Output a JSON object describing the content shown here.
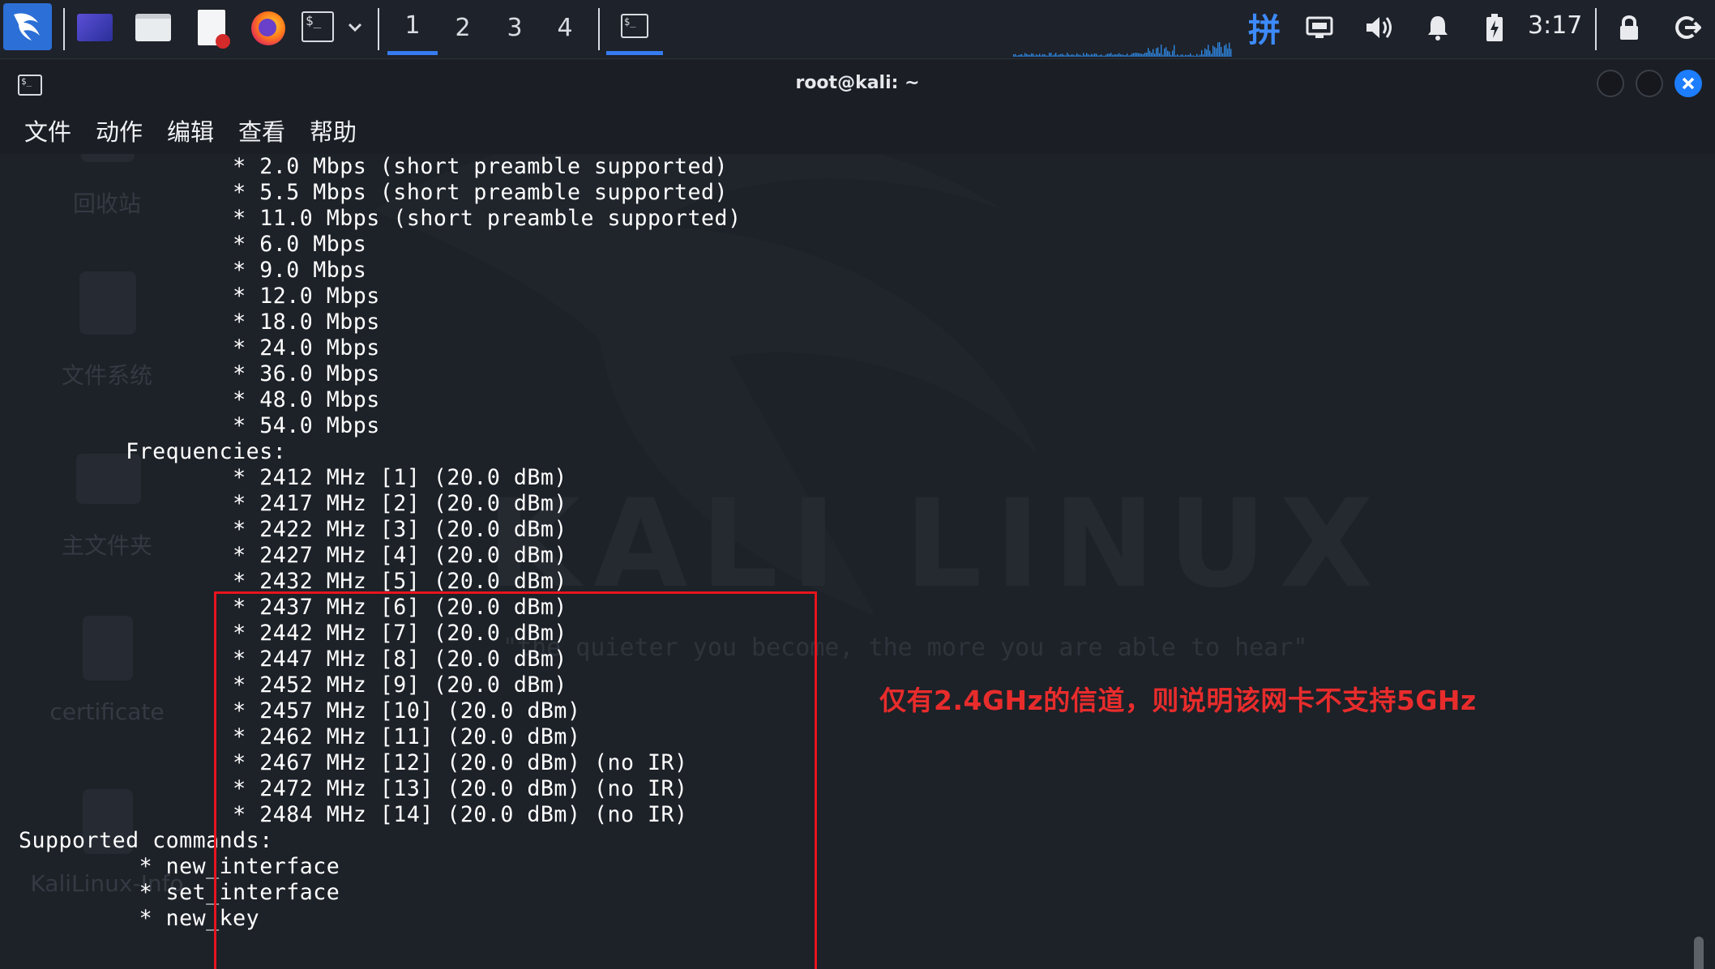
{
  "taskbar": {
    "workspaces": [
      "1",
      "2",
      "3",
      "4"
    ],
    "active_workspace": "1",
    "input_method": "拼",
    "clock": "3:17",
    "launchers": [
      "kali-menu-icon",
      "desktop-icon",
      "file-manager-icon",
      "text-editor-icon",
      "firefox-icon",
      "terminal-icon"
    ],
    "tray_icons": [
      "keyboard-layout-icon",
      "network-icon",
      "volume-icon",
      "notification-bell-icon",
      "battery-charging-icon",
      "lock-icon",
      "logout-icon"
    ]
  },
  "window": {
    "title": "root@kali: ~",
    "menu": [
      "文件",
      "动作",
      "编辑",
      "查看",
      "帮助"
    ]
  },
  "desktop": {
    "icons": [
      "回收站",
      "文件系统",
      "主文件夹",
      "certificate",
      "KaliLinux-Info"
    ],
    "wallpaper_logo": "KALI LINUX",
    "wallpaper_quote": "\"the quieter you become, the more you are able to hear\""
  },
  "terminal": {
    "lines": [
      "\t\t* 2.0 Mbps (short preamble supported)",
      "\t\t* 5.5 Mbps (short preamble supported)",
      "\t\t* 11.0 Mbps (short preamble supported)",
      "\t\t* 6.0 Mbps",
      "\t\t* 9.0 Mbps",
      "\t\t* 12.0 Mbps",
      "\t\t* 18.0 Mbps",
      "\t\t* 24.0 Mbps",
      "\t\t* 36.0 Mbps",
      "\t\t* 48.0 Mbps",
      "\t\t* 54.0 Mbps",
      "\tFrequencies:",
      "\t\t* 2412 MHz [1] (20.0 dBm)",
      "\t\t* 2417 MHz [2] (20.0 dBm)",
      "\t\t* 2422 MHz [3] (20.0 dBm)",
      "\t\t* 2427 MHz [4] (20.0 dBm)",
      "\t\t* 2432 MHz [5] (20.0 dBm)",
      "\t\t* 2437 MHz [6] (20.0 dBm)",
      "\t\t* 2442 MHz [7] (20.0 dBm)",
      "\t\t* 2447 MHz [8] (20.0 dBm)",
      "\t\t* 2452 MHz [9] (20.0 dBm)",
      "\t\t* 2457 MHz [10] (20.0 dBm)",
      "\t\t* 2462 MHz [11] (20.0 dBm)",
      "\t\t* 2467 MHz [12] (20.0 dBm) (no IR)",
      "\t\t* 2472 MHz [13] (20.0 dBm) (no IR)",
      "\t\t* 2484 MHz [14] (20.0 dBm) (no IR)",
      "Supported commands:",
      "\t * new_interface",
      "\t * set_interface",
      "\t * new_key"
    ]
  },
  "annotation": {
    "text": "仅有2.4GHz的信道，则说明该网卡不支持5GHz",
    "color": "#e82c2c"
  },
  "colors": {
    "accent": "#367bf0",
    "highlight_border": "#e8141e",
    "close_button": "#1d7dff"
  }
}
